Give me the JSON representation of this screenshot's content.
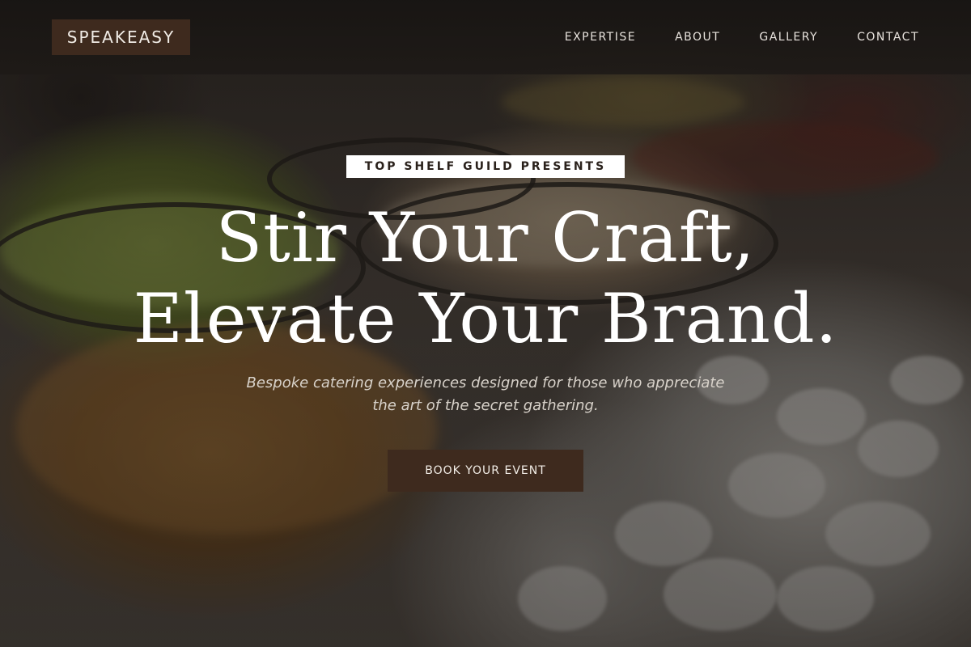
{
  "brand": {
    "logo_text": "SPEAKEASY"
  },
  "nav": {
    "items": [
      {
        "label": "EXPERTISE"
      },
      {
        "label": "ABOUT"
      },
      {
        "label": "GALLERY"
      },
      {
        "label": "CONTACT"
      }
    ]
  },
  "hero": {
    "eyebrow": "TOP SHELF GUILD PRESENTS",
    "headline_line1": "Stir Your Craft,",
    "headline_line2": "Elevate Your Brand.",
    "subtitle_line1": "Bespoke catering experiences designed for those who appreciate",
    "subtitle_line2": "the art of the secret gathering.",
    "cta_label": "BOOK YOUR EVENT",
    "background_image": "catering-buffet-photo"
  },
  "colors": {
    "accent": "#3e2a1e",
    "header_bg": "#1e1a17",
    "text_light": "#ffffff",
    "eyebrow_bg": "#ffffff"
  }
}
